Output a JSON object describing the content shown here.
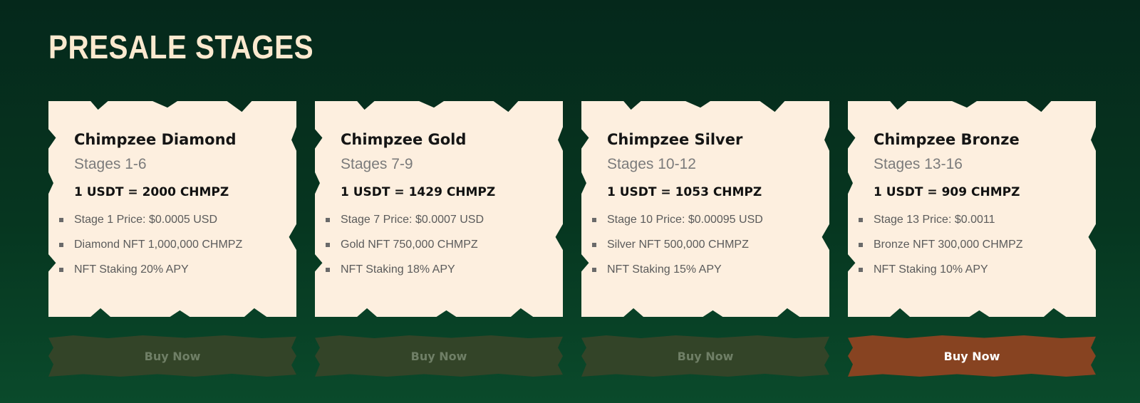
{
  "heading": "PRESALE STAGES",
  "stages": [
    {
      "name": "Chimpzee Diamond",
      "stages_label": "Stages 1-6",
      "rate": "1 USDT = 2000 CHMPZ",
      "features": [
        "Stage 1 Price: $0.0005 USD",
        "Diamond NFT 1,000,000 CHMPZ",
        "NFT Staking 20% APY"
      ],
      "button_label": "Buy Now",
      "button_state": "disabled"
    },
    {
      "name": "Chimpzee Gold",
      "stages_label": "Stages 7-9",
      "rate": "1 USDT = 1429 CHMPZ",
      "features": [
        "Stage 7 Price: $0.0007 USD",
        "Gold NFT 750,000 CHMPZ",
        "NFT Staking 18% APY"
      ],
      "button_label": "Buy Now",
      "button_state": "disabled"
    },
    {
      "name": "Chimpzee Silver",
      "stages_label": "Stages 10-12",
      "rate": "1 USDT = 1053 CHMPZ",
      "features": [
        "Stage 10 Price: $0.00095 USD",
        "Silver NFT 500,000 CHMPZ",
        "NFT Staking 15% APY"
      ],
      "button_label": "Buy Now",
      "button_state": "disabled"
    },
    {
      "name": "Chimpzee Bronze",
      "stages_label": "Stages 13-16",
      "rate": "1 USDT = 909 CHMPZ",
      "features": [
        "Stage 13 Price: $0.0011",
        "Bronze NFT 300,000 CHMPZ",
        "NFT Staking 10% APY"
      ],
      "button_label": "Buy Now",
      "button_state": "active"
    }
  ],
  "colors": {
    "background": "#063620",
    "heading": "#fbe9cf",
    "card": "#fdefdf",
    "button_disabled": "#334428",
    "button_active": "#874321"
  }
}
